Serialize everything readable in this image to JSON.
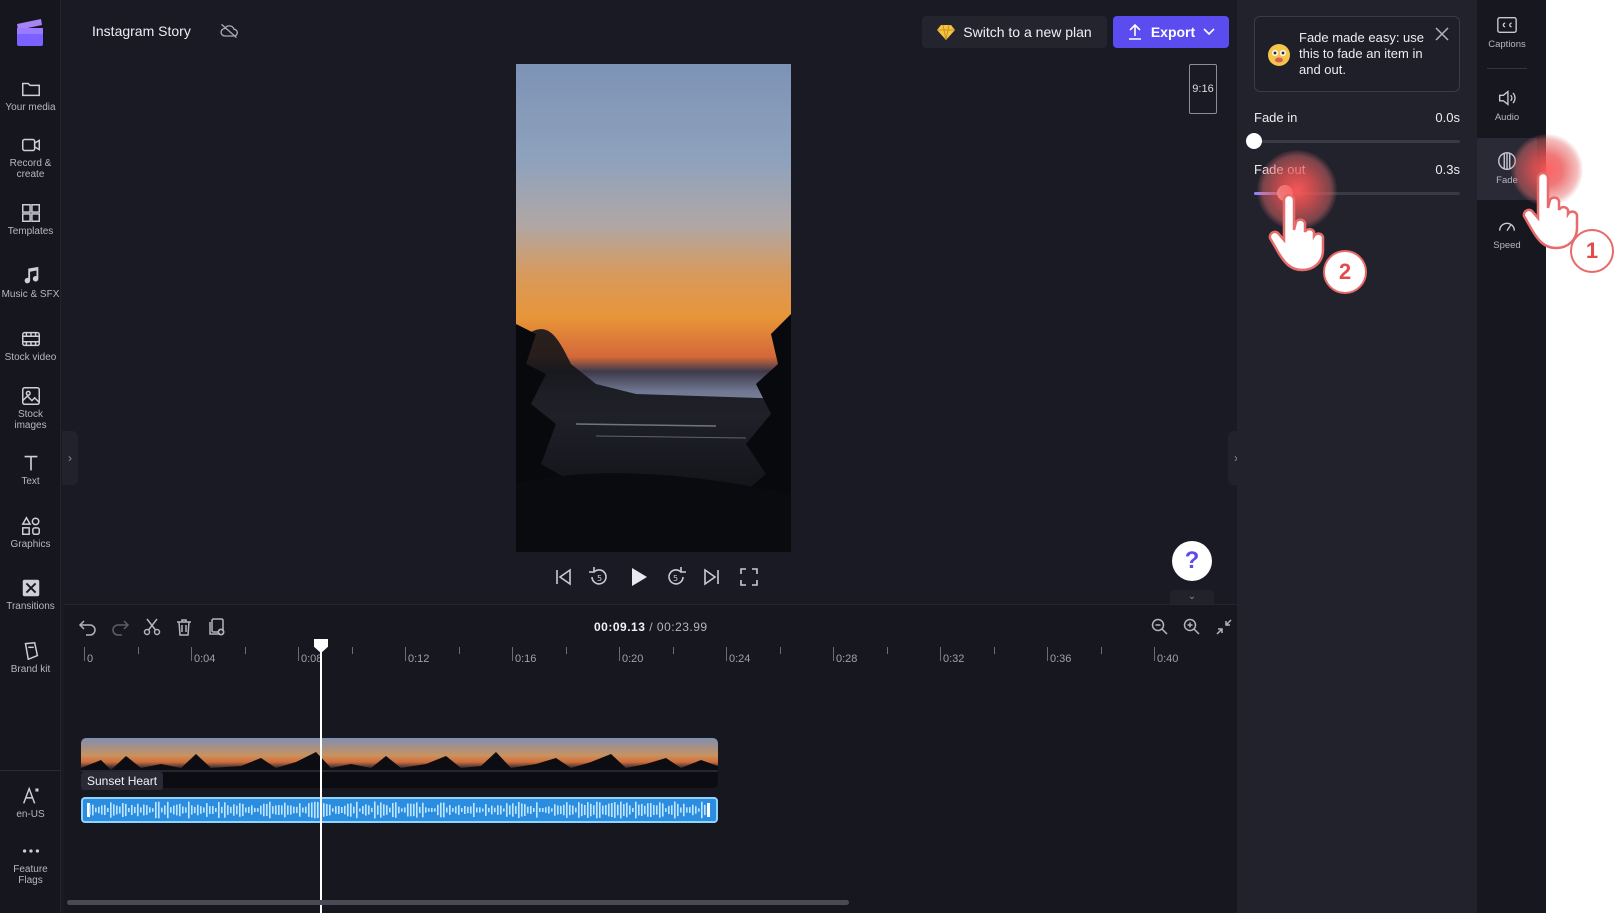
{
  "header": {
    "project_title": "Instagram Story",
    "switch_plan_label": "Switch to a new plan",
    "export_label": "Export"
  },
  "sidebar": {
    "items": [
      {
        "label": "Your media",
        "icon": "folder-icon"
      },
      {
        "label": "Record &\ncreate",
        "icon": "camera-icon"
      },
      {
        "label": "Templates",
        "icon": "templates-icon"
      },
      {
        "label": "Music & SFX",
        "icon": "music-icon"
      },
      {
        "label": "Stock video",
        "icon": "film-icon"
      },
      {
        "label": "Stock\nimages",
        "icon": "image-icon"
      },
      {
        "label": "Text",
        "icon": "text-icon"
      },
      {
        "label": "Graphics",
        "icon": "shapes-icon"
      },
      {
        "label": "Transitions",
        "icon": "transitions-icon"
      },
      {
        "label": "Brand kit",
        "icon": "brand-kit-icon"
      }
    ],
    "bottom_items": [
      {
        "label": "en-US",
        "icon": "language-icon"
      },
      {
        "label": "Feature\nFlags",
        "icon": "more-icon"
      }
    ]
  },
  "preview": {
    "aspect_ratio": "9:16"
  },
  "timeline": {
    "current_time": "00:09.13",
    "separator": " / ",
    "total_time": "00:23.99",
    "ruler_labels": [
      "0",
      "0:04",
      "0:08",
      "0:12",
      "0:16",
      "0:20",
      "0:24",
      "0:28",
      "0:32",
      "0:36",
      "0:40"
    ],
    "clip_label": "Sunset Heart"
  },
  "properties": {
    "tooltip": "Fade made easy: use this to fade an item in and out.",
    "fade_in_label": "Fade in",
    "fade_in_value": "0.0s",
    "fade_out_label": "Fade out",
    "fade_out_value": "0.3s",
    "fade_in_fraction": 0.0,
    "fade_out_fraction": 0.15
  },
  "right_rail": {
    "items": [
      {
        "label": "Captions",
        "icon": "captions-icon"
      },
      {
        "label": "Audio",
        "icon": "speaker-icon"
      },
      {
        "label": "Fade",
        "icon": "fade-icon"
      },
      {
        "label": "Speed",
        "icon": "speed-icon"
      }
    ]
  },
  "overlay": {
    "step_1": "1",
    "step_2": "2"
  },
  "colors": {
    "accent": "#5b4cf0",
    "background": "#1a1a24",
    "audio_track": "#2a8de0",
    "tutorial_highlight": "#e86a6a"
  }
}
